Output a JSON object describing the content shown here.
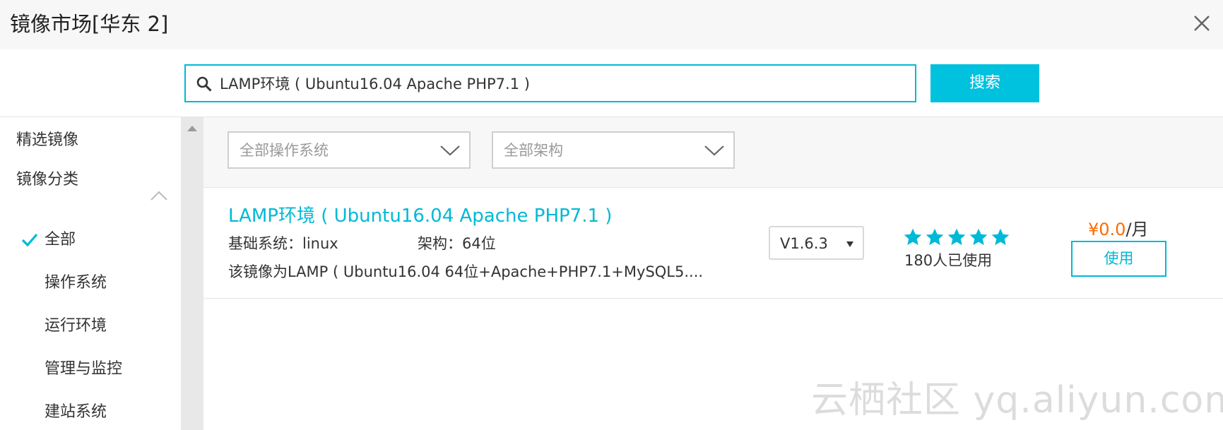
{
  "window": {
    "title": "镜像市场[华东 2]"
  },
  "search": {
    "value": "LAMP环境 ( Ubuntu16.04 Apache PHP7.1 )",
    "button_label": "搜索"
  },
  "sidebar": {
    "items": [
      {
        "label": "精选镜像"
      },
      {
        "label": "镜像分类"
      },
      {
        "label": "全部"
      },
      {
        "label": "操作系统"
      },
      {
        "label": "运行环境"
      },
      {
        "label": "管理与监控"
      },
      {
        "label": "建站系统"
      }
    ]
  },
  "filters": {
    "os_label": "全部操作系统",
    "arch_label": "全部架构"
  },
  "result": {
    "title": "LAMP环境 ( Ubuntu16.04 Apache PHP7.1 )",
    "base_system": "基础系统：linux",
    "arch": "架构：64位",
    "description": "该镜像为LAMP ( Ubuntu16.04 64位+Apache+PHP7.1+MySQL5....",
    "version": "V1.6.3",
    "rating": 5,
    "rating_max": 5,
    "usage": "180人已使用",
    "price_value": "¥0.0",
    "price_unit": "/月",
    "use_label": "使用"
  },
  "watermark": "云栖社区 yq.aliyun.com",
  "colors": {
    "accent": "#00c1de",
    "link": "#00b9d6",
    "price": "#ff6a00"
  }
}
